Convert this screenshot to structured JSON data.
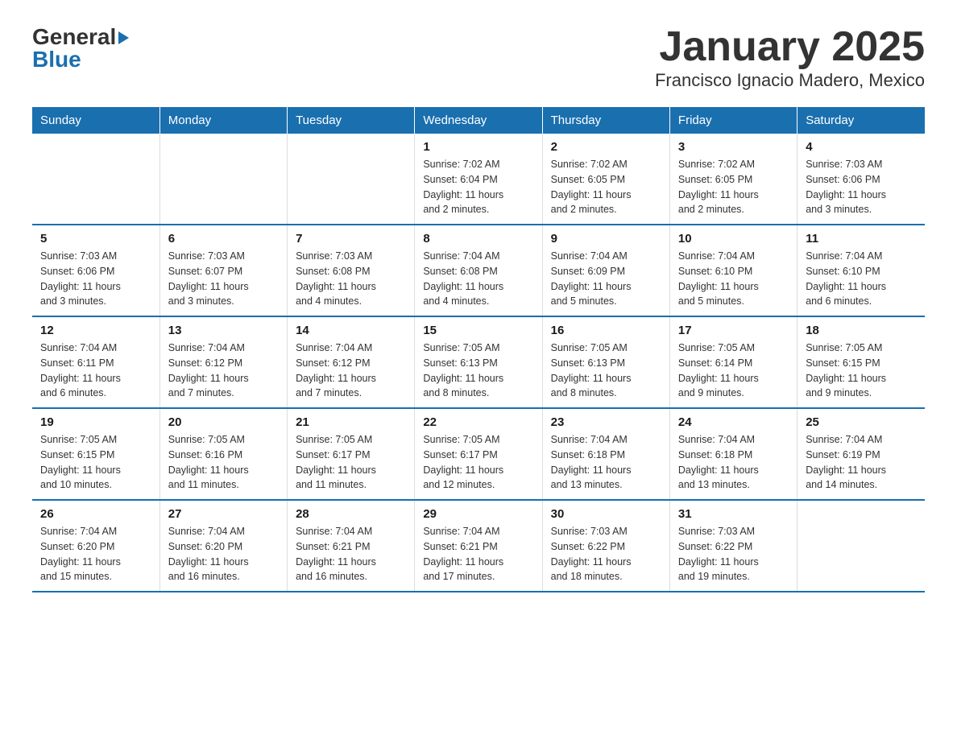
{
  "logo": {
    "text_general": "General",
    "text_blue": "Blue",
    "line2": "Blue"
  },
  "title": "January 2025",
  "subtitle": "Francisco Ignacio Madero, Mexico",
  "days_of_week": [
    "Sunday",
    "Monday",
    "Tuesday",
    "Wednesday",
    "Thursday",
    "Friday",
    "Saturday"
  ],
  "weeks": [
    [
      {
        "day": "",
        "info": ""
      },
      {
        "day": "",
        "info": ""
      },
      {
        "day": "",
        "info": ""
      },
      {
        "day": "1",
        "info": "Sunrise: 7:02 AM\nSunset: 6:04 PM\nDaylight: 11 hours\nand 2 minutes."
      },
      {
        "day": "2",
        "info": "Sunrise: 7:02 AM\nSunset: 6:05 PM\nDaylight: 11 hours\nand 2 minutes."
      },
      {
        "day": "3",
        "info": "Sunrise: 7:02 AM\nSunset: 6:05 PM\nDaylight: 11 hours\nand 2 minutes."
      },
      {
        "day": "4",
        "info": "Sunrise: 7:03 AM\nSunset: 6:06 PM\nDaylight: 11 hours\nand 3 minutes."
      }
    ],
    [
      {
        "day": "5",
        "info": "Sunrise: 7:03 AM\nSunset: 6:06 PM\nDaylight: 11 hours\nand 3 minutes."
      },
      {
        "day": "6",
        "info": "Sunrise: 7:03 AM\nSunset: 6:07 PM\nDaylight: 11 hours\nand 3 minutes."
      },
      {
        "day": "7",
        "info": "Sunrise: 7:03 AM\nSunset: 6:08 PM\nDaylight: 11 hours\nand 4 minutes."
      },
      {
        "day": "8",
        "info": "Sunrise: 7:04 AM\nSunset: 6:08 PM\nDaylight: 11 hours\nand 4 minutes."
      },
      {
        "day": "9",
        "info": "Sunrise: 7:04 AM\nSunset: 6:09 PM\nDaylight: 11 hours\nand 5 minutes."
      },
      {
        "day": "10",
        "info": "Sunrise: 7:04 AM\nSunset: 6:10 PM\nDaylight: 11 hours\nand 5 minutes."
      },
      {
        "day": "11",
        "info": "Sunrise: 7:04 AM\nSunset: 6:10 PM\nDaylight: 11 hours\nand 6 minutes."
      }
    ],
    [
      {
        "day": "12",
        "info": "Sunrise: 7:04 AM\nSunset: 6:11 PM\nDaylight: 11 hours\nand 6 minutes."
      },
      {
        "day": "13",
        "info": "Sunrise: 7:04 AM\nSunset: 6:12 PM\nDaylight: 11 hours\nand 7 minutes."
      },
      {
        "day": "14",
        "info": "Sunrise: 7:04 AM\nSunset: 6:12 PM\nDaylight: 11 hours\nand 7 minutes."
      },
      {
        "day": "15",
        "info": "Sunrise: 7:05 AM\nSunset: 6:13 PM\nDaylight: 11 hours\nand 8 minutes."
      },
      {
        "day": "16",
        "info": "Sunrise: 7:05 AM\nSunset: 6:13 PM\nDaylight: 11 hours\nand 8 minutes."
      },
      {
        "day": "17",
        "info": "Sunrise: 7:05 AM\nSunset: 6:14 PM\nDaylight: 11 hours\nand 9 minutes."
      },
      {
        "day": "18",
        "info": "Sunrise: 7:05 AM\nSunset: 6:15 PM\nDaylight: 11 hours\nand 9 minutes."
      }
    ],
    [
      {
        "day": "19",
        "info": "Sunrise: 7:05 AM\nSunset: 6:15 PM\nDaylight: 11 hours\nand 10 minutes."
      },
      {
        "day": "20",
        "info": "Sunrise: 7:05 AM\nSunset: 6:16 PM\nDaylight: 11 hours\nand 11 minutes."
      },
      {
        "day": "21",
        "info": "Sunrise: 7:05 AM\nSunset: 6:17 PM\nDaylight: 11 hours\nand 11 minutes."
      },
      {
        "day": "22",
        "info": "Sunrise: 7:05 AM\nSunset: 6:17 PM\nDaylight: 11 hours\nand 12 minutes."
      },
      {
        "day": "23",
        "info": "Sunrise: 7:04 AM\nSunset: 6:18 PM\nDaylight: 11 hours\nand 13 minutes."
      },
      {
        "day": "24",
        "info": "Sunrise: 7:04 AM\nSunset: 6:18 PM\nDaylight: 11 hours\nand 13 minutes."
      },
      {
        "day": "25",
        "info": "Sunrise: 7:04 AM\nSunset: 6:19 PM\nDaylight: 11 hours\nand 14 minutes."
      }
    ],
    [
      {
        "day": "26",
        "info": "Sunrise: 7:04 AM\nSunset: 6:20 PM\nDaylight: 11 hours\nand 15 minutes."
      },
      {
        "day": "27",
        "info": "Sunrise: 7:04 AM\nSunset: 6:20 PM\nDaylight: 11 hours\nand 16 minutes."
      },
      {
        "day": "28",
        "info": "Sunrise: 7:04 AM\nSunset: 6:21 PM\nDaylight: 11 hours\nand 16 minutes."
      },
      {
        "day": "29",
        "info": "Sunrise: 7:04 AM\nSunset: 6:21 PM\nDaylight: 11 hours\nand 17 minutes."
      },
      {
        "day": "30",
        "info": "Sunrise: 7:03 AM\nSunset: 6:22 PM\nDaylight: 11 hours\nand 18 minutes."
      },
      {
        "day": "31",
        "info": "Sunrise: 7:03 AM\nSunset: 6:22 PM\nDaylight: 11 hours\nand 19 minutes."
      },
      {
        "day": "",
        "info": ""
      }
    ]
  ]
}
